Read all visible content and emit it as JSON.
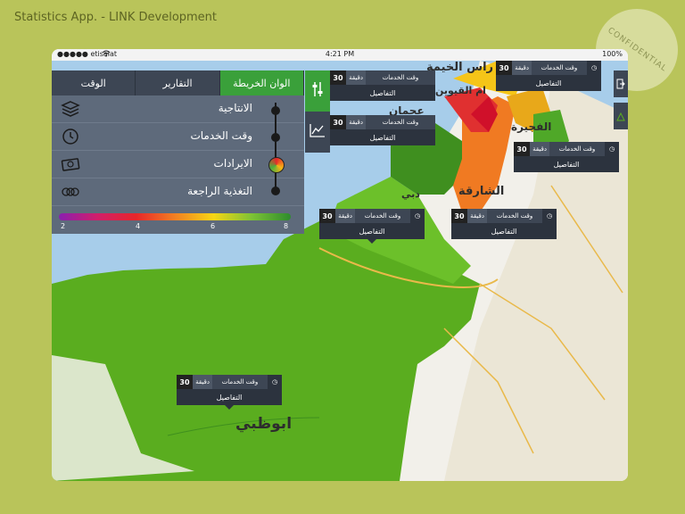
{
  "header": {
    "title": "Statistics App. - LINK Development",
    "stamp": "CONFIDENTIAL"
  },
  "statusbar": {
    "carrier": "●●●●● etisalat",
    "time": "4:21 PM",
    "battery": "100%"
  },
  "panel": {
    "tabs": [
      {
        "label": "الوقت",
        "active": false
      },
      {
        "label": "التقارير",
        "active": false
      },
      {
        "label": "الوان الخريطة",
        "active": true
      }
    ],
    "layers": [
      {
        "label": "الانتاجية",
        "icon": "layers-icon"
      },
      {
        "label": "وقت الخدمات",
        "icon": "clock-icon"
      },
      {
        "label": "الايرادات",
        "icon": "money-icon"
      },
      {
        "label": "التغذية الراجعة",
        "icon": "feedback-icon"
      }
    ],
    "legend_ticks": [
      "2",
      "4",
      "6",
      "8"
    ]
  },
  "tools": {
    "filter": "sliders-icon",
    "trend": "line-chart-icon"
  },
  "right_tools": [
    "logout-icon",
    "alert-icon"
  ],
  "callout": {
    "value": "30",
    "unit": "دقيقة",
    "service": "وقت الخدمات",
    "details": "التفاصيل"
  },
  "cities": [
    "راس الخيمة",
    "ام القيوين",
    "عجمان",
    "الفجيرة",
    "دبي",
    "الشارقة",
    "ابوظبي"
  ],
  "colors": {
    "background": "#b9c45a",
    "accent": "#3aa03a",
    "panel": "#5e6a7b",
    "dark": "#3d4654",
    "sea": "#a7cdea"
  }
}
